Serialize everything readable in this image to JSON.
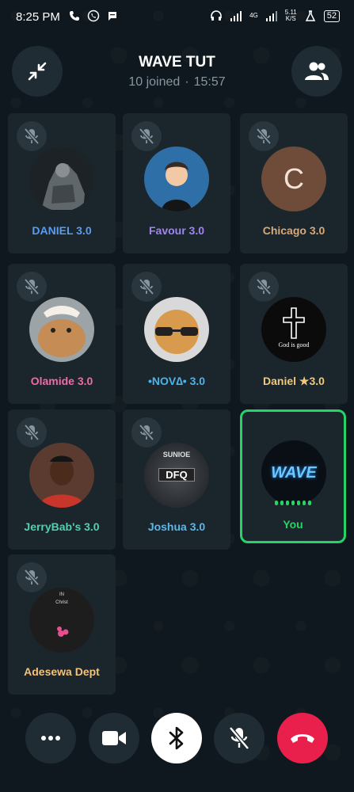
{
  "status_bar": {
    "time": "8:25 PM",
    "network_type": "4G",
    "data_speed": "5.11",
    "data_unit": "K/S",
    "battery": "52"
  },
  "header": {
    "title": "WAVE TUT",
    "joined": "10 joined",
    "separator": "·",
    "duration": "15:57"
  },
  "participants": [
    {
      "name": "DANIEL 3.0",
      "color": "#5b9bf0",
      "avatar": "dark-figure"
    },
    {
      "name": "Favour 3.0",
      "color": "#a084f0",
      "avatar": "cartoon-boy"
    },
    {
      "name": "Chicago 3.0",
      "color": "#d8a878",
      "avatar_letter": "C",
      "avatar_bg": "#6f4c3a"
    },
    {
      "name": "Olamide 3.0",
      "color": "#f06ba8",
      "avatar": "dog-photo"
    },
    {
      "name": "•NOV∆• 3.0",
      "color": "#4fb3e8",
      "avatar": "cat-sunglasses"
    },
    {
      "name": "Daniel ★3.0",
      "color": "#f0c97a",
      "avatar": "cross",
      "avatar_text": "God is good"
    },
    {
      "name": "JerryBab's 3.0",
      "color": "#4fd1b0",
      "avatar": "boy-photo"
    },
    {
      "name": "Joshua 3.0",
      "color": "#5ab8e8",
      "avatar": "dfq-logo",
      "avatar_text_top": "SUNIOE",
      "avatar_text_main": "DFQ"
    },
    {
      "name": "You",
      "color": "#25d366",
      "avatar": "wave-logo",
      "avatar_text": "WAVE",
      "speaking": true
    },
    {
      "name": "Adesewa Dept",
      "color": "#f5c27a",
      "avatar": "in-christ",
      "avatar_text_1": "IN",
      "avatar_text_2": "Christ"
    }
  ],
  "controls": {
    "more": "more-options",
    "video": "video",
    "audio_route": "bluetooth",
    "mute": "microphone-muted",
    "end": "end-call",
    "end_color": "#e9204c",
    "accent": "#25d366"
  }
}
